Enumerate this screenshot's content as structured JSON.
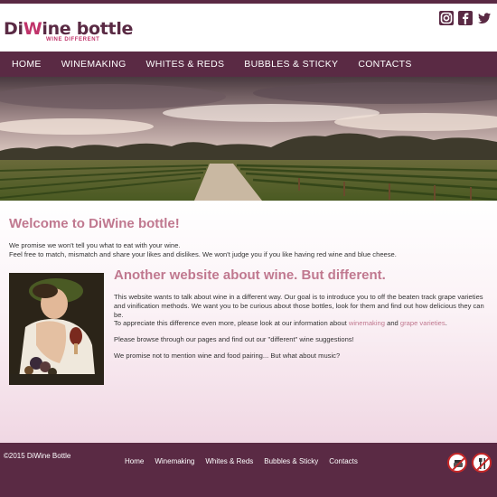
{
  "header": {
    "logo_main_a": "Di",
    "logo_main_b": "W",
    "logo_main_c": "ine bottle",
    "logo_sub": "WINE DIFFERENT",
    "social_icons": [
      "instagram-icon",
      "facebook-icon",
      "twitter-icon"
    ]
  },
  "nav": {
    "items": [
      "HOME",
      "WINEMAKING",
      "WHITES & REDS",
      "BUBBLES & STICKY",
      "CONTACTS"
    ]
  },
  "main": {
    "welcome_title": "Welcome to DiWine bottle!",
    "intro_line1": "We promise we won't tell you what to eat with your wine.",
    "intro_line2": "Feel free to match, mismatch and share your likes and dislikes. We won't judge you if you like having red wine and blue cheese.",
    "subtitle": "Another website about wine. But different.",
    "para1": "This website wants to talk about wine in a different way. Our goal is to introduce you to off the beaten track grape varieties and vinification methods. We want you to be curious about those bottles, look for them and find out how delicious they can be.",
    "para2_prefix": "To appreciate this difference even more, please look at our information about ",
    "link_winemaking": "winemaking",
    "para2_and": " and ",
    "link_grape": "grape varieties",
    "para2_suffix": ".",
    "para3": "Please browse through our pages and find out our \"different\" wine suggestions!",
    "para4": "We promise not to mention wine and food pairing... But what about music?"
  },
  "footer": {
    "copyright": "©2015 DiWine Bottle",
    "nav": [
      "Home",
      "Winemaking",
      "Whites & Reds",
      "Bubbles & Sticky",
      "Contacts"
    ]
  },
  "colors": {
    "brand_plum": "#5a2a44",
    "accent_pink": "#c0788f",
    "logo_magenta": "#c0336a"
  }
}
